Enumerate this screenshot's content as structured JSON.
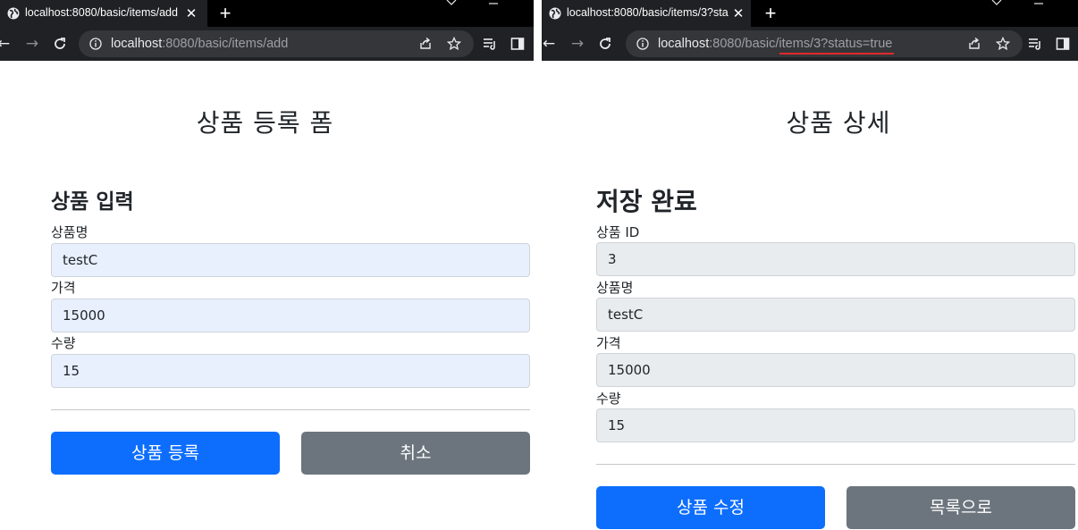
{
  "left": {
    "tab_title": "localhost:8080/basic/items/add",
    "url_host": "localhost",
    "url_rest": ":8080/basic/items/add",
    "page_title": "상품 등록 폼",
    "section_heading": "상품 입력",
    "fields": [
      {
        "label": "상품명",
        "value": "testC"
      },
      {
        "label": "가격",
        "value": "15000"
      },
      {
        "label": "수량",
        "value": "15"
      }
    ],
    "primary_button": "상품 등록",
    "secondary_button": "취소"
  },
  "right": {
    "tab_title": "localhost:8080/basic/items/3?sta",
    "url_host": "localhost",
    "url_rest": ":8080/basic/items/3?status=true",
    "page_title": "상품 상세",
    "section_heading": "저장 완료",
    "fields": [
      {
        "label": "상품 ID",
        "value": "3"
      },
      {
        "label": "상품명",
        "value": "testC"
      },
      {
        "label": "가격",
        "value": "15000"
      },
      {
        "label": "수량",
        "value": "15"
      }
    ],
    "primary_button": "상품 수정",
    "secondary_button": "목록으로"
  },
  "icons": {
    "tab_favicon": "globe-icon",
    "tab_close": "close-icon",
    "new_tab": "plus-icon",
    "back": "arrow-left-icon",
    "forward": "arrow-right-icon",
    "reload": "reload-icon",
    "site_info": "info-icon",
    "share": "share-icon",
    "bookmark": "star-icon",
    "reading_list": "reading-list-icon",
    "side_panel": "side-panel-icon"
  },
  "colors": {
    "primary": "#0d6efd",
    "secondary": "#6c757d",
    "autofill_bg": "#e8f0fe",
    "readonly_bg": "#e9ecef",
    "url_highlight": "#e0292b"
  }
}
